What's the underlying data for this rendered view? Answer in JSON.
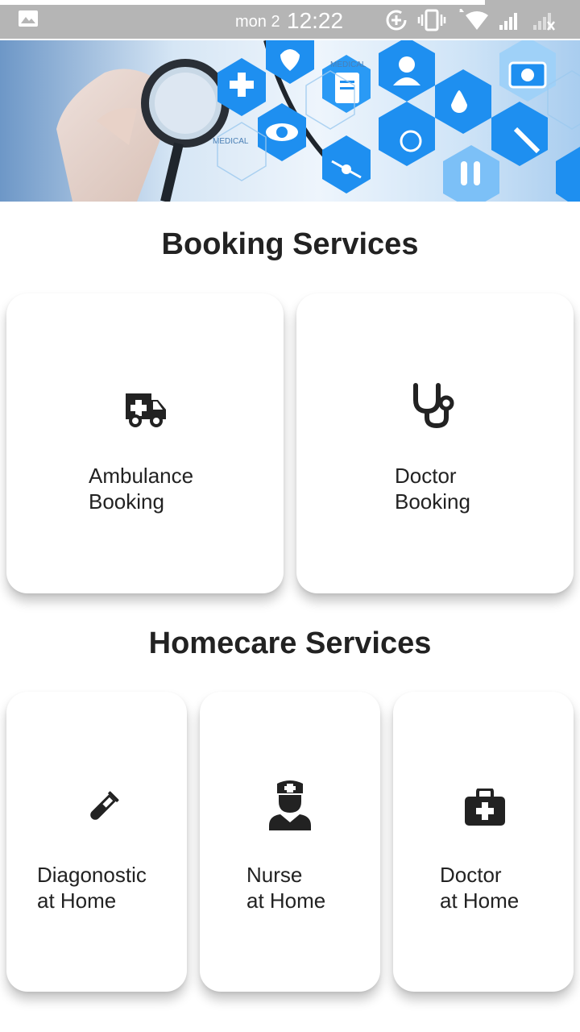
{
  "status_bar": {
    "date": "mon 2",
    "time": "12:22"
  },
  "banner": {
    "labels": [
      "MEDICAL",
      "MEDICAL"
    ]
  },
  "booking_section": {
    "title": "Booking Services",
    "cards": [
      {
        "icon": "ambulance-icon",
        "line1": "Ambulance",
        "line2": "Booking"
      },
      {
        "icon": "stethoscope-icon",
        "line1": "Doctor",
        "line2": "Booking"
      }
    ]
  },
  "homecare_section": {
    "title": "Homecare Services",
    "cards": [
      {
        "icon": "test-tube-icon",
        "line1": "Diagonostic",
        "line2": "at Home"
      },
      {
        "icon": "nurse-icon",
        "line1": "Nurse",
        "line2": "at Home"
      },
      {
        "icon": "medical-kit-icon",
        "line1": "Doctor",
        "line2": "at Home"
      }
    ]
  },
  "colors": {
    "status_bar": "#b5b5b5",
    "banner_blue": "#1e8ff0",
    "text": "#222222",
    "icon": "#222222"
  }
}
